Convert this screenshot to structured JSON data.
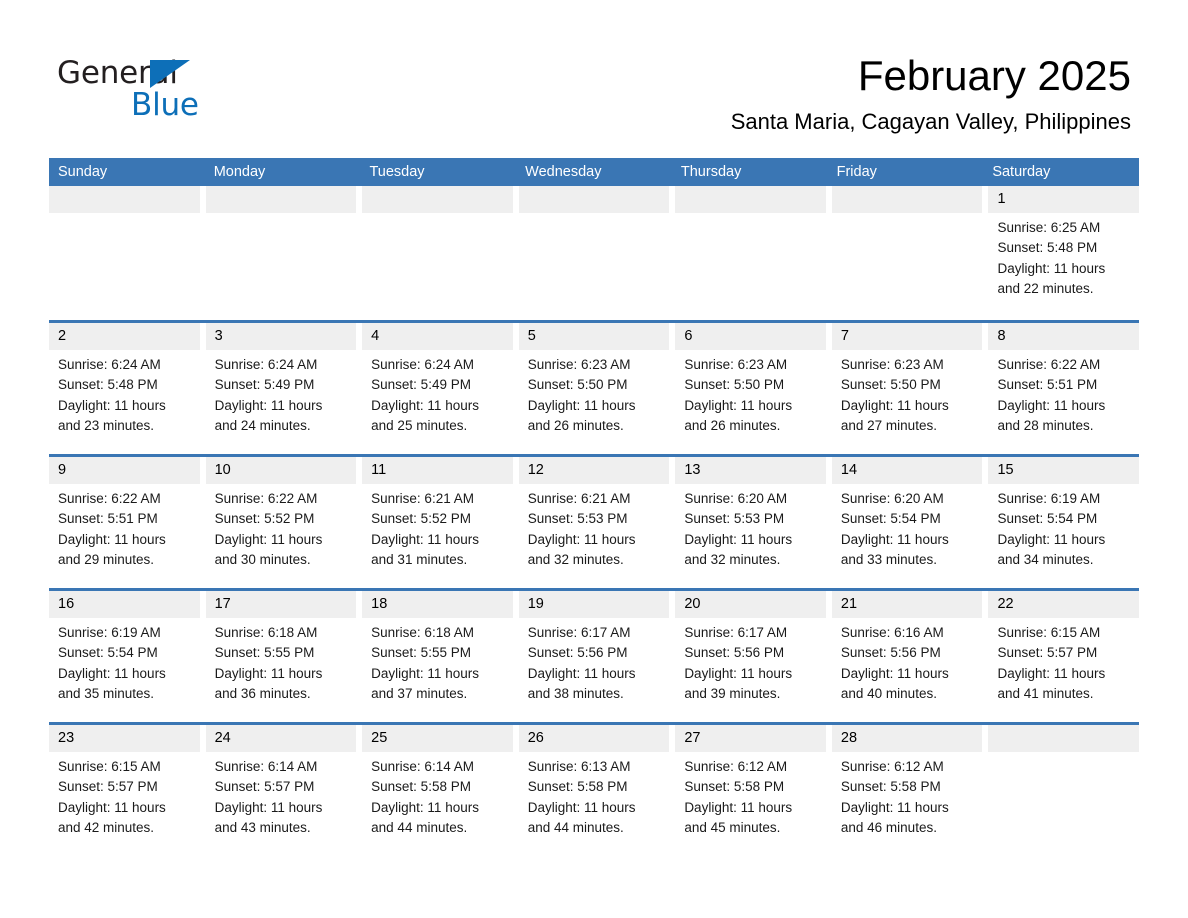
{
  "logo": {
    "word_one": "General",
    "word_two": "Blue",
    "triangle_icon": "blue-triangle-icon",
    "brand_color": "#0d6fb8"
  },
  "header": {
    "title": "February 2025",
    "subtitle": "Santa Maria, Cagayan Valley, Philippines"
  },
  "theme": {
    "header_blue": "#3a76b4",
    "daynum_gray": "#efefef",
    "text_black": "#000000"
  },
  "calendar": {
    "weekdays": [
      "Sunday",
      "Monday",
      "Tuesday",
      "Wednesday",
      "Thursday",
      "Friday",
      "Saturday"
    ],
    "weeks": [
      [
        {
          "day": "",
          "sunrise": "",
          "sunset": "",
          "daylight": ""
        },
        {
          "day": "",
          "sunrise": "",
          "sunset": "",
          "daylight": ""
        },
        {
          "day": "",
          "sunrise": "",
          "sunset": "",
          "daylight": ""
        },
        {
          "day": "",
          "sunrise": "",
          "sunset": "",
          "daylight": ""
        },
        {
          "day": "",
          "sunrise": "",
          "sunset": "",
          "daylight": ""
        },
        {
          "day": "",
          "sunrise": "",
          "sunset": "",
          "daylight": ""
        },
        {
          "day": "1",
          "sunrise": "Sunrise: 6:25 AM",
          "sunset": "Sunset: 5:48 PM",
          "daylight": "Daylight: 11 hours and 22 minutes."
        }
      ],
      [
        {
          "day": "2",
          "sunrise": "Sunrise: 6:24 AM",
          "sunset": "Sunset: 5:48 PM",
          "daylight": "Daylight: 11 hours and 23 minutes."
        },
        {
          "day": "3",
          "sunrise": "Sunrise: 6:24 AM",
          "sunset": "Sunset: 5:49 PM",
          "daylight": "Daylight: 11 hours and 24 minutes."
        },
        {
          "day": "4",
          "sunrise": "Sunrise: 6:24 AM",
          "sunset": "Sunset: 5:49 PM",
          "daylight": "Daylight: 11 hours and 25 minutes."
        },
        {
          "day": "5",
          "sunrise": "Sunrise: 6:23 AM",
          "sunset": "Sunset: 5:50 PM",
          "daylight": "Daylight: 11 hours and 26 minutes."
        },
        {
          "day": "6",
          "sunrise": "Sunrise: 6:23 AM",
          "sunset": "Sunset: 5:50 PM",
          "daylight": "Daylight: 11 hours and 26 minutes."
        },
        {
          "day": "7",
          "sunrise": "Sunrise: 6:23 AM",
          "sunset": "Sunset: 5:50 PM",
          "daylight": "Daylight: 11 hours and 27 minutes."
        },
        {
          "day": "8",
          "sunrise": "Sunrise: 6:22 AM",
          "sunset": "Sunset: 5:51 PM",
          "daylight": "Daylight: 11 hours and 28 minutes."
        }
      ],
      [
        {
          "day": "9",
          "sunrise": "Sunrise: 6:22 AM",
          "sunset": "Sunset: 5:51 PM",
          "daylight": "Daylight: 11 hours and 29 minutes."
        },
        {
          "day": "10",
          "sunrise": "Sunrise: 6:22 AM",
          "sunset": "Sunset: 5:52 PM",
          "daylight": "Daylight: 11 hours and 30 minutes."
        },
        {
          "day": "11",
          "sunrise": "Sunrise: 6:21 AM",
          "sunset": "Sunset: 5:52 PM",
          "daylight": "Daylight: 11 hours and 31 minutes."
        },
        {
          "day": "12",
          "sunrise": "Sunrise: 6:21 AM",
          "sunset": "Sunset: 5:53 PM",
          "daylight": "Daylight: 11 hours and 32 minutes."
        },
        {
          "day": "13",
          "sunrise": "Sunrise: 6:20 AM",
          "sunset": "Sunset: 5:53 PM",
          "daylight": "Daylight: 11 hours and 32 minutes."
        },
        {
          "day": "14",
          "sunrise": "Sunrise: 6:20 AM",
          "sunset": "Sunset: 5:54 PM",
          "daylight": "Daylight: 11 hours and 33 minutes."
        },
        {
          "day": "15",
          "sunrise": "Sunrise: 6:19 AM",
          "sunset": "Sunset: 5:54 PM",
          "daylight": "Daylight: 11 hours and 34 minutes."
        }
      ],
      [
        {
          "day": "16",
          "sunrise": "Sunrise: 6:19 AM",
          "sunset": "Sunset: 5:54 PM",
          "daylight": "Daylight: 11 hours and 35 minutes."
        },
        {
          "day": "17",
          "sunrise": "Sunrise: 6:18 AM",
          "sunset": "Sunset: 5:55 PM",
          "daylight": "Daylight: 11 hours and 36 minutes."
        },
        {
          "day": "18",
          "sunrise": "Sunrise: 6:18 AM",
          "sunset": "Sunset: 5:55 PM",
          "daylight": "Daylight: 11 hours and 37 minutes."
        },
        {
          "day": "19",
          "sunrise": "Sunrise: 6:17 AM",
          "sunset": "Sunset: 5:56 PM",
          "daylight": "Daylight: 11 hours and 38 minutes."
        },
        {
          "day": "20",
          "sunrise": "Sunrise: 6:17 AM",
          "sunset": "Sunset: 5:56 PM",
          "daylight": "Daylight: 11 hours and 39 minutes."
        },
        {
          "day": "21",
          "sunrise": "Sunrise: 6:16 AM",
          "sunset": "Sunset: 5:56 PM",
          "daylight": "Daylight: 11 hours and 40 minutes."
        },
        {
          "day": "22",
          "sunrise": "Sunrise: 6:15 AM",
          "sunset": "Sunset: 5:57 PM",
          "daylight": "Daylight: 11 hours and 41 minutes."
        }
      ],
      [
        {
          "day": "23",
          "sunrise": "Sunrise: 6:15 AM",
          "sunset": "Sunset: 5:57 PM",
          "daylight": "Daylight: 11 hours and 42 minutes."
        },
        {
          "day": "24",
          "sunrise": "Sunrise: 6:14 AM",
          "sunset": "Sunset: 5:57 PM",
          "daylight": "Daylight: 11 hours and 43 minutes."
        },
        {
          "day": "25",
          "sunrise": "Sunrise: 6:14 AM",
          "sunset": "Sunset: 5:58 PM",
          "daylight": "Daylight: 11 hours and 44 minutes."
        },
        {
          "day": "26",
          "sunrise": "Sunrise: 6:13 AM",
          "sunset": "Sunset: 5:58 PM",
          "daylight": "Daylight: 11 hours and 44 minutes."
        },
        {
          "day": "27",
          "sunrise": "Sunrise: 6:12 AM",
          "sunset": "Sunset: 5:58 PM",
          "daylight": "Daylight: 11 hours and 45 minutes."
        },
        {
          "day": "28",
          "sunrise": "Sunrise: 6:12 AM",
          "sunset": "Sunset: 5:58 PM",
          "daylight": "Daylight: 11 hours and 46 minutes."
        },
        {
          "day": "",
          "sunrise": "",
          "sunset": "",
          "daylight": ""
        }
      ]
    ]
  }
}
